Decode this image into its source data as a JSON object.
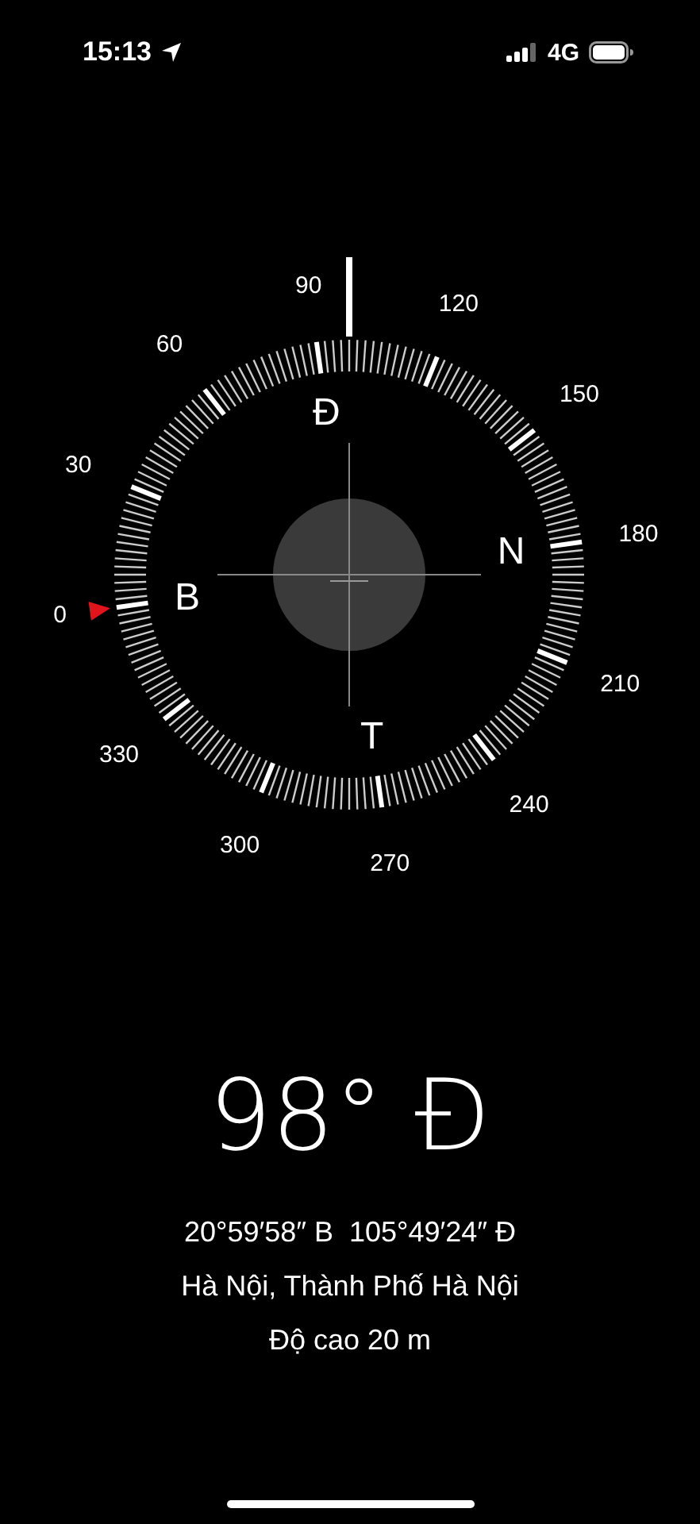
{
  "status_bar": {
    "time": "15:13",
    "network": "4G"
  },
  "compass": {
    "degree_labels": [
      "0",
      "30",
      "60",
      "90",
      "120",
      "150",
      "180",
      "210",
      "240",
      "270",
      "300",
      "330"
    ],
    "cardinals": [
      "B",
      "Đ",
      "N",
      "T"
    ]
  },
  "heading": "98° Đ",
  "coordinates": "20°59′58″ B  105°49′24″ Đ",
  "location": "Hà Nội, Thành Phố Hà Nội",
  "altitude": "Độ cao 20 m"
}
